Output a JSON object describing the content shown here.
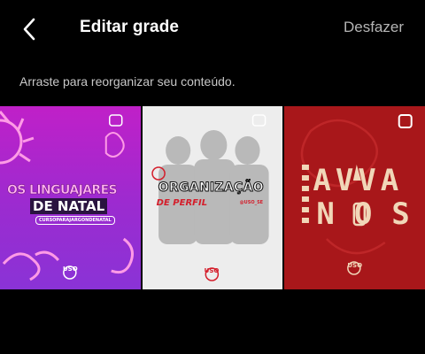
{
  "header": {
    "back_icon": "chevron-left-icon",
    "title": "Editar grade",
    "undo_label": "Desfazer"
  },
  "instruction": "Arraste para reorganizar seu conteúdo.",
  "grid": {
    "tiles": [
      {
        "line1": "OS LINGUAJARES",
        "line2": "DE NATAL",
        "caption": "CURSOPARAJARGONDENATAL",
        "logo": "USO",
        "colors": {
          "bg": "#b52acb",
          "accent": "#ff9be6"
        }
      },
      {
        "line1": "ORGANIZAÇÃO",
        "line2": "DE PERFIL",
        "caption": "@USO_SE",
        "logo": "USO",
        "colors": {
          "bg": "#ededed",
          "accent": "#d41d2a"
        }
      },
      {
        "line1": "AVVA",
        "line2": "NOS",
        "logo": "USO",
        "colors": {
          "bg": "#a8171a",
          "accent": "#f1d7b8"
        }
      }
    ]
  },
  "colors": {
    "background": "#000000",
    "muted_text": "#b5b5b5"
  }
}
